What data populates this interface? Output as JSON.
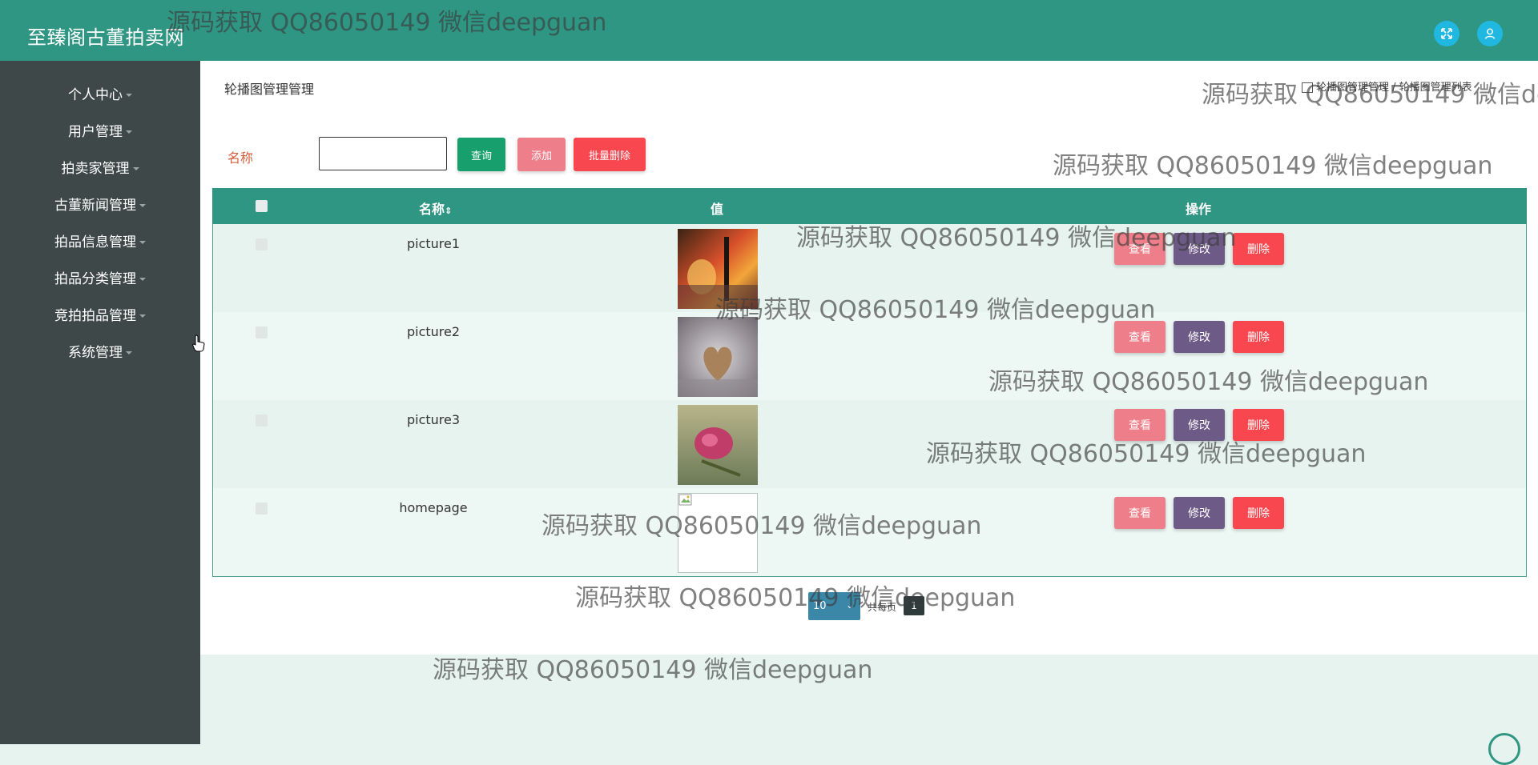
{
  "app": {
    "title": "至臻阁古董拍卖网"
  },
  "header_icons": [
    "fullscreen-icon",
    "user-icon"
  ],
  "sidebar": {
    "items": [
      {
        "label": "个人中心"
      },
      {
        "label": "用户管理"
      },
      {
        "label": "拍卖家管理"
      },
      {
        "label": "古董新闻管理"
      },
      {
        "label": "拍品信息管理"
      },
      {
        "label": "拍品分类管理"
      },
      {
        "label": "竞拍拍品管理"
      },
      {
        "label": "系统管理"
      }
    ]
  },
  "page": {
    "heading": "轮播图管理管理",
    "breadcrumb": "轮播图管理管理 / 轮播图管理列表"
  },
  "search": {
    "label": "名称",
    "value": "",
    "query_label": "查询",
    "add_label": "添加",
    "batch_delete_label": "批量删除"
  },
  "table": {
    "headers": {
      "name": "名称",
      "value": "值",
      "actions": "操作"
    },
    "rows": [
      {
        "name": "picture1",
        "image": "picture1"
      },
      {
        "name": "picture2",
        "image": "picture2"
      },
      {
        "name": "picture3",
        "image": "picture3"
      },
      {
        "name": "homepage",
        "image": "broken"
      }
    ],
    "actions": {
      "view": "查看",
      "edit": "修改",
      "delete": "删除"
    }
  },
  "pagination": {
    "page_size": "10",
    "label": "共每页",
    "current_page": "1"
  },
  "watermark": "源码获取 QQ86050149 微信deepguan",
  "colors": {
    "header": "#2f9683",
    "sidebar": "#3f4848",
    "query": "#17a06d",
    "add_view": "#ee7f8a",
    "edit": "#6e5a87",
    "delete": "#f9474f",
    "table_body": "#e6f3ee"
  }
}
